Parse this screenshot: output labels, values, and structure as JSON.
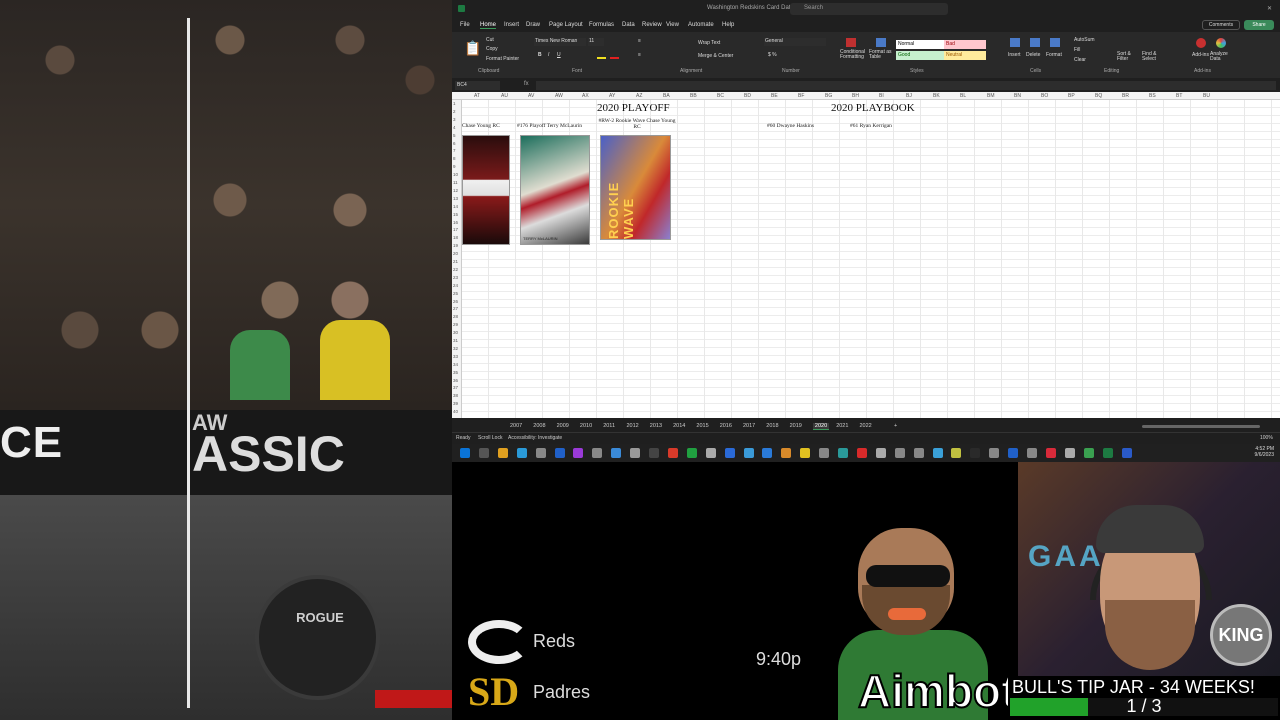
{
  "stream_left": {
    "banner_text_1": "CE",
    "banner_text_2": "ASSIC",
    "banner_text_3": "AW",
    "plate_text": "ROGUE"
  },
  "excel": {
    "window_title": "Washington Redskins Card Database",
    "search_placeholder": "Search",
    "menu": [
      "File",
      "Home",
      "Insert",
      "Draw",
      "Page Layout",
      "Formulas",
      "Data",
      "Review",
      "View",
      "Automate",
      "Help"
    ],
    "active_menu": "Home",
    "comments_label": "Comments",
    "share_label": "Share",
    "ribbon": {
      "clipboard": {
        "label": "Clipboard",
        "paste": "Paste",
        "cut": "Cut",
        "copy": "Copy",
        "format_painter": "Format Painter"
      },
      "font": {
        "label": "Font",
        "font_name": "Times New Roman",
        "font_size": "11"
      },
      "alignment": {
        "label": "Alignment",
        "wrap_text": "Wrap Text",
        "merge_center": "Merge & Center"
      },
      "number": {
        "label": "Number",
        "format": "General"
      },
      "styles": {
        "label": "Styles",
        "conditional": "Conditional Formatting",
        "format_table": "Format as Table",
        "normal": "Normal",
        "bad": "Bad",
        "good": "Good",
        "neutral": "Neutral"
      },
      "cells": {
        "label": "Cells",
        "insert": "Insert",
        "delete": "Delete",
        "format": "Format"
      },
      "editing": {
        "label": "Editing",
        "autosum": "AutoSum",
        "fill": "Fill",
        "clear": "Clear",
        "sort_filter": "Sort & Filter",
        "find_select": "Find & Select"
      },
      "addins": {
        "label": "Add-ins",
        "addins": "Add-ins",
        "analyze": "Analyze Data"
      }
    },
    "name_box": "BC4",
    "fx_label": "fx",
    "columns": [
      "AT",
      "AU",
      "AV",
      "AW",
      "AX",
      "AY",
      "AZ",
      "BA",
      "BB",
      "BC",
      "BD",
      "BE",
      "BF",
      "BG",
      "BH",
      "BI",
      "BJ",
      "BK",
      "BL",
      "BM",
      "BN",
      "BO",
      "BP",
      "BQ",
      "BR",
      "BS",
      "BT",
      "BU"
    ],
    "rows": [
      "1",
      "2",
      "3",
      "4",
      "5",
      "6",
      "7",
      "8",
      "9",
      "10",
      "11",
      "12",
      "13",
      "14",
      "15",
      "16",
      "17",
      "18",
      "19",
      "20",
      "21",
      "22",
      "23",
      "24",
      "25",
      "26",
      "27",
      "28",
      "29",
      "30",
      "31",
      "32",
      "33",
      "34",
      "35",
      "36",
      "37",
      "38",
      "39",
      "40"
    ],
    "sections": {
      "playoff_title": "2020 PLAYOFF",
      "playbook_title": "2020 PLAYBOOK"
    },
    "card_labels": {
      "card1": "Chase Young RC",
      "card2": "#176 Playoff Terry McLaurin",
      "card3": "#RW-2 Rookie Wave Chase Young RC",
      "card4": "#60 Dwayne Haskins",
      "card5": "#61 Ryan Kerrigan"
    },
    "card3_text": "ROOKIE WAVE",
    "card2_caption": "TERRY McLAURIN",
    "sheet_tabs": [
      "2007",
      "2008",
      "2009",
      "2010",
      "2011",
      "2012",
      "2013",
      "2014",
      "2015",
      "2016",
      "2017",
      "2018",
      "2019",
      "2020",
      "2021",
      "2022"
    ],
    "active_tab": "2020",
    "add_sheet": "+",
    "status": {
      "ready": "Ready",
      "scroll_lock": "Scroll Lock",
      "accessibility": "Accessibility: Investigate",
      "zoom": "100%"
    },
    "clock": {
      "time": "4:52 PM",
      "date": "9/6/2023"
    }
  },
  "scoreboard": {
    "team1": "Reds",
    "team2": "Padres",
    "logo1": "C",
    "logo2": "SD",
    "time": "9:40p"
  },
  "mascot": {
    "name": "Aimbot"
  },
  "webcam": {
    "neon": "GAA",
    "badge": "KING"
  },
  "tipjar": {
    "title": "BULL'S TIP JAR - 34 WEEKS!",
    "count": "1 / 3",
    "progress": 0.29,
    "bar_color": "#21a22a"
  }
}
